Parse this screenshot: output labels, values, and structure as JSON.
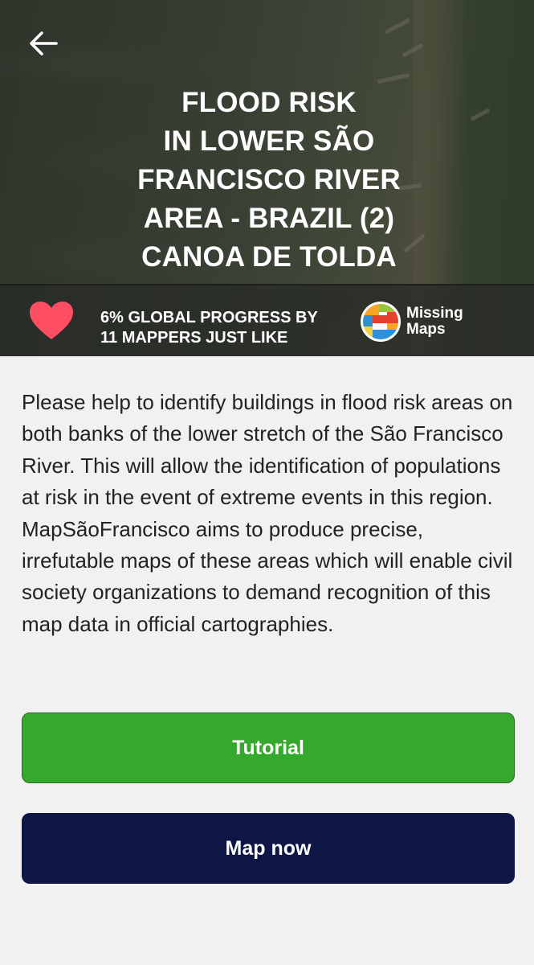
{
  "header": {
    "back_icon": "arrow-left-icon",
    "title": "FLOOD RISK\nIN LOWER SÃO\nFRANCISCO RIVER\nAREA - BRAZIL (2)\nCANOA DE TOLDA"
  },
  "stats": {
    "heart_icon": "heart-icon",
    "heart_color": "#ff4d63",
    "progress_text": "6% GLOBAL PROGRESS BY\n11 MAPPERS JUST LIKE",
    "progress_percent": 6,
    "mapper_count": 11,
    "logo_text": "Missing\nMaps"
  },
  "description": "Please help to identify buildings in flood risk areas on both banks of the lower stretch of the São Francisco River. This will allow the identification of populations at risk in the event of extreme events in this region. MapSãoFrancisco aims to produce precise, irrefutable maps of these areas which will enable civil society organizations to demand recognition of this map data in official cartographies.",
  "actions": {
    "tutorial_label": "Tutorial",
    "map_now_label": "Map now"
  },
  "colors": {
    "tutorial_button": "#35a92e",
    "map_now_button": "#0d1645",
    "page_background": "#f1f1f1"
  }
}
